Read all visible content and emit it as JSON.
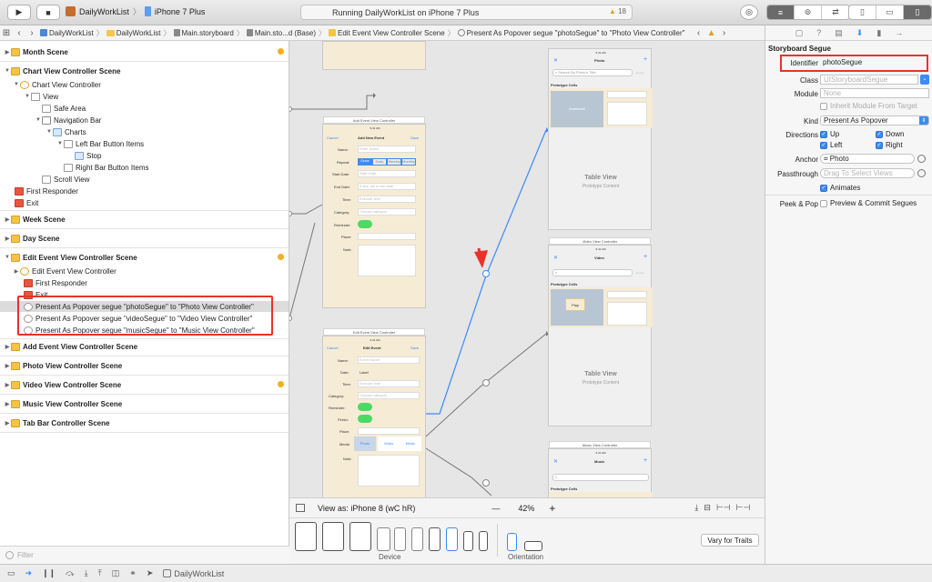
{
  "toolbar": {
    "run_icon": "play-icon",
    "stop_icon": "stop-icon",
    "scheme_name": "DailyWorkList",
    "device_name": "iPhone 7 Plus",
    "status_text": "Running DailyWorkList on iPhone 7 Plus",
    "warning_count": "18"
  },
  "jumpbar": {
    "crumbs": [
      "DailyWorkList",
      "DailyWorkList",
      "Main.storyboard",
      "Main.sto...d (Base)",
      "Edit Event View Controller Scene",
      "Present As Popover segue \"photoSegue\" to \"Photo View Controller\""
    ]
  },
  "outline": {
    "rows": [
      {
        "label": "Month Scene"
      },
      {
        "label": "Chart View Controller Scene"
      },
      {
        "label": "Chart View Controller"
      },
      {
        "label": "View"
      },
      {
        "label": "Safe Area"
      },
      {
        "label": "Navigation Bar"
      },
      {
        "label": "Charts"
      },
      {
        "label": "Left Bar Button Items"
      },
      {
        "label": "Stop"
      },
      {
        "label": "Right Bar Button Items"
      },
      {
        "label": "Scroll View"
      },
      {
        "label": "First Responder"
      },
      {
        "label": "Exit"
      },
      {
        "label": "Week Scene"
      },
      {
        "label": "Day Scene"
      },
      {
        "label": "Edit Event View Controller Scene"
      },
      {
        "label": "Edit Event View Controller"
      },
      {
        "label": "First Responder"
      },
      {
        "label": "Exit"
      },
      {
        "label": "Present As Popover segue \"photoSegue\" to \"Photo View Controller\""
      },
      {
        "label": "Present As Popover segue \"videoSegue\" to \"Video View Controller\""
      },
      {
        "label": "Present As Popover segue \"musicSegue\" to \"Music View Controller\""
      },
      {
        "label": "Add Event View Controller Scene"
      },
      {
        "label": "Photo View Controller Scene"
      },
      {
        "label": "Video View Controller Scene"
      },
      {
        "label": "Music View Controller Scene"
      },
      {
        "label": "Tab Bar Controller Scene"
      }
    ]
  },
  "filter_placeholder": "Filter",
  "canvas": {
    "add_event": {
      "title": "Add Event View Controller",
      "time": "9:41 AM",
      "cancel": "Cancel",
      "nav_title": "Add New Event",
      "save": "Save",
      "name": "Name:",
      "name_ph": "Enter Name",
      "repeat": "Repeat:",
      "repeat_opts": [
        "Once",
        "Daily",
        "Weekly",
        "Monthly"
      ],
      "start": "Start Date:",
      "start_ph": "Start Date",
      "end": "End Date:",
      "end_ph": "If any, set a due date",
      "time_lbl": "Time:",
      "time_ph": "Execute time",
      "category": "Category:",
      "category_ph": "Choose category",
      "reminder": "Reminder:",
      "place": "Place:",
      "note": "Note:"
    },
    "edit_event": {
      "title": "Edit Event View Controller",
      "time": "9:41 AM",
      "cancel": "Cancel",
      "nav_title": "Edit Event",
      "save": "Save",
      "name": "Name:",
      "name_ph": "Event Name",
      "date": "Date:",
      "date_val": "Label",
      "time_lbl": "Time:",
      "time_ph": "Execute time",
      "category": "Category:",
      "category_ph": "Choose category",
      "reminder": "Reminder:",
      "finish": "Finish:",
      "place": "Place:",
      "media": "Media",
      "media_opts": [
        "Photo",
        "Video",
        "Music"
      ],
      "note": "Note:"
    },
    "photo": {
      "time": "9:41 AM",
      "nav_title": "Photo",
      "search": "Search By Photo's Title",
      "cancel": "Cancel",
      "proto": "Prototype Cells",
      "thumb": "thumbnail",
      "table": "Table View",
      "table_sub": "Prototype Content"
    },
    "video": {
      "title": "Video View Controller",
      "time": "9:41 AM",
      "nav_title": "Video",
      "cancel": "Cancel",
      "proto": "Prototype Cells",
      "play": "Play",
      "table": "Table View",
      "table_sub": "Prototype Content"
    },
    "music": {
      "title": "Music View Controller",
      "time": "9:41 AM",
      "nav_title": "Music",
      "proto": "Prototype Cells"
    }
  },
  "view_as": {
    "label": "View as: iPhone 8 (wC hR)",
    "zoom": "42%",
    "minus": "—",
    "plus": "+"
  },
  "devices": {
    "device_label": "Device",
    "orientation_label": "Orientation",
    "vary_button": "Vary for Traits"
  },
  "inspector": {
    "section": "Storyboard Segue",
    "identifier_label": "Identifier",
    "identifier_value": "photoSegue",
    "class_label": "Class",
    "class_ph": "UIStoryboardSegue",
    "module_label": "Module",
    "module_ph": "None",
    "inherit_label": "Inherit Module From Target",
    "kind_label": "Kind",
    "kind_value": "Present As Popover",
    "directions_label": "Directions",
    "dir_up": "Up",
    "dir_down": "Down",
    "dir_left": "Left",
    "dir_right": "Right",
    "anchor_label": "Anchor",
    "anchor_value": "Photo",
    "passthrough_label": "Passthrough",
    "passthrough_ph": "Drag To Select Views",
    "animates_label": "Animates",
    "peek_label": "Peek & Pop",
    "preview_label": "Preview & Commit Segues"
  },
  "bottom": {
    "app_label": "DailyWorkList"
  },
  "colors": {
    "accent": "#3d8bf4",
    "highlight": "#e8332a",
    "warning": "#f2b01e"
  }
}
